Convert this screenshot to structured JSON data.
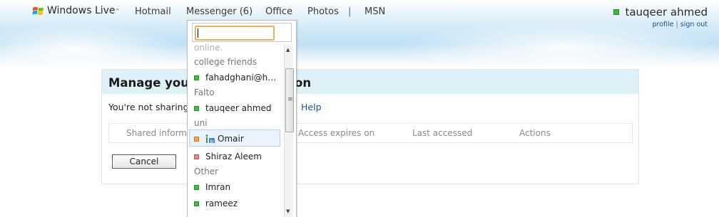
{
  "header": {
    "logo_text": "Windows Live",
    "logo_tm": "™",
    "nav": [
      "Hotmail",
      "Messenger (6)",
      "Office",
      "Photos",
      "MSN"
    ],
    "separator": "|",
    "user_name": "tauqeer ahmed",
    "profile_link": "profile",
    "links_sep": "|",
    "signout_link": "sign out"
  },
  "panel": {
    "title_left": "Manage your",
    "title_right": "on",
    "sharing_text": "You're not sharing",
    "help_link": "Help",
    "columns": [
      "Shared informa",
      "Access expires on",
      "Last accessed",
      "Actions"
    ],
    "cancel_label": "Cancel"
  },
  "messenger": {
    "search_value": "",
    "items": [
      {
        "type": "group",
        "text": "online."
      },
      {
        "type": "group",
        "text": "college friends"
      },
      {
        "type": "contact",
        "text": "fahadghani@h…",
        "status": "green"
      },
      {
        "type": "group",
        "text": "Falto"
      },
      {
        "type": "contact",
        "text": "tauqeer ahmed",
        "status": "green"
      },
      {
        "type": "group",
        "text": "uni"
      },
      {
        "type": "contact",
        "text": "Omair",
        "status": "orange",
        "icon": "im-icon"
      },
      {
        "type": "contact",
        "text": "Shiraz Aleem",
        "status": "red"
      },
      {
        "type": "group",
        "text": "Other"
      },
      {
        "type": "contact",
        "text": "Imran",
        "status": "green"
      },
      {
        "type": "contact",
        "text": "rameez",
        "status": "green"
      }
    ]
  },
  "colors": {
    "link": "#1e4e8c",
    "online": "#3cc03c",
    "away": "#f5a845",
    "busy": "#ea8a8a",
    "panel_header": "#def0f8"
  }
}
